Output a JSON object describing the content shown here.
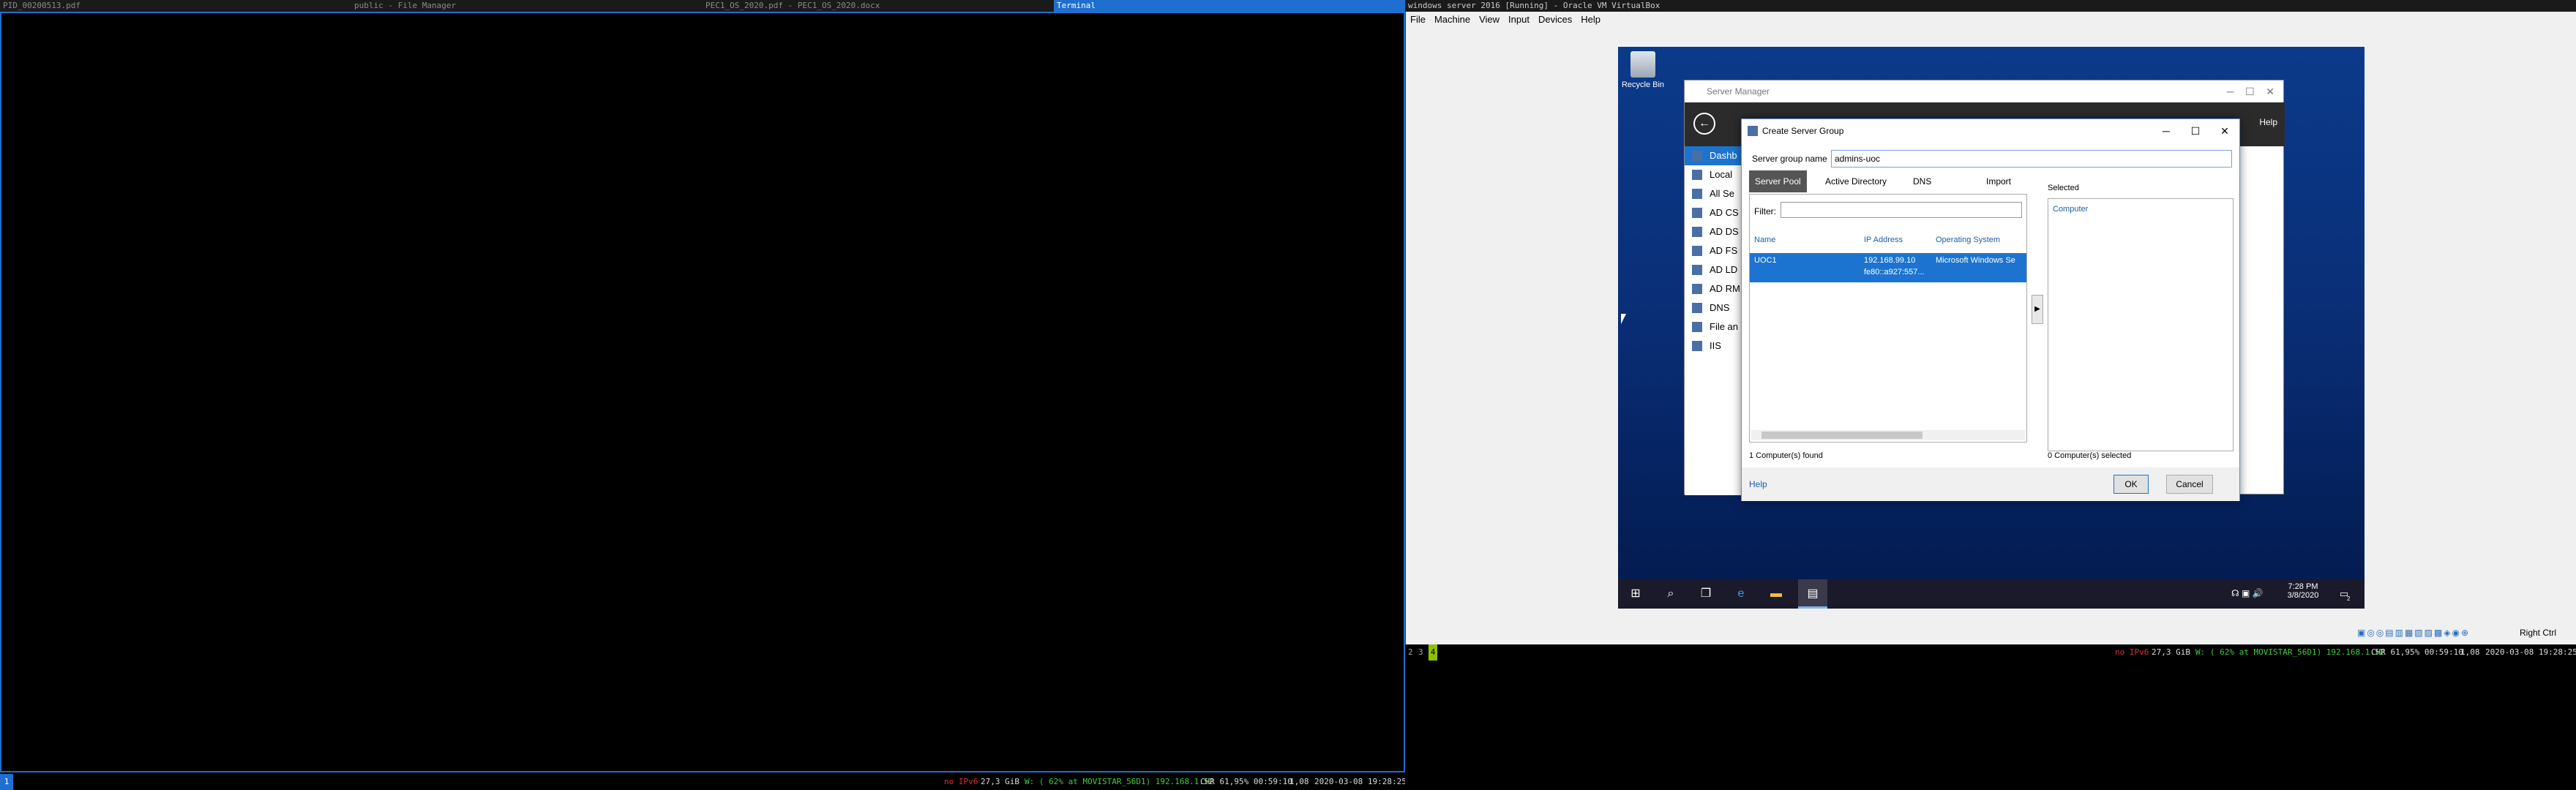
{
  "tabs": [
    {
      "label": "PID_00200513.pdf",
      "active": false
    },
    {
      "label": "public - File Manager",
      "active": false
    },
    {
      "label": "PEC1_OS_2020.pdf - PEC1_OS_2020.docx",
      "active": false
    },
    {
      "label": "Terminal",
      "active": true
    },
    {
      "label": "windows server 2016 [Running] - Oracle VM VirtualBox",
      "active": false
    }
  ],
  "statusbar_left": {
    "workspace": "1",
    "ipv6": "no IPv6",
    "disk": "27,3 GiB",
    "wifi": "W: ( 62% at MOVISTAR_56D1) 192.168.1.52",
    "cpu": "CHR 61,95% 00:59:10",
    "load": "1,08",
    "datetime": "2020-03-08 19:28:25"
  },
  "statusbar_right": {
    "workspaces": [
      "2",
      "3",
      "4"
    ],
    "ipv6": "no IPv6",
    "disk": "27,3 GiB",
    "wifi": "W: ( 62% at MOVISTAR_56D1) 192.168.1.52",
    "cpu": "CHR 61,95% 00:59:10",
    "load": "1,08",
    "datetime": "2020-03-08 19:28:25"
  },
  "vbox": {
    "menu": [
      "File",
      "Machine",
      "View",
      "Input",
      "Devices",
      "Help"
    ],
    "host_key": "Right Ctrl"
  },
  "desktop": {
    "recycle_bin": "Recycle Bin"
  },
  "server_manager": {
    "title": "Server Manager",
    "help": "Help",
    "sidebar": [
      "Dashb",
      "Local",
      "All Se",
      "AD CS",
      "AD DS",
      "AD FS",
      "AD LD",
      "AD RM",
      "DNS",
      "File an",
      "IIS"
    ]
  },
  "dialog": {
    "title": "Create Server Group",
    "group_name_label": "Server group name",
    "group_name_value": "admins-uoc",
    "tabs": [
      "Server Pool",
      "Active Directory",
      "DNS",
      "Import"
    ],
    "filter_label": "Filter:",
    "columns": [
      "Name",
      "IP Address",
      "Operating System"
    ],
    "rows": [
      {
        "name": "UOC1",
        "ip": "192.168.99.10",
        "ip2": "fe80::a927:557...",
        "os": "Microsoft Windows Se"
      }
    ],
    "found": "1 Computer(s) found",
    "selected_label": "Selected",
    "selected_column": "Computer",
    "selected_count": "0 Computer(s) selected",
    "help": "Help",
    "ok": "OK",
    "cancel": "Cancel"
  },
  "taskbar": {
    "time": "7:28 PM",
    "date": "3/8/2020",
    "notif": "2"
  },
  "colors": {
    "accent": "#1e6fd0",
    "terminal_bg": "#000000",
    "selection": "#1c74d0"
  }
}
